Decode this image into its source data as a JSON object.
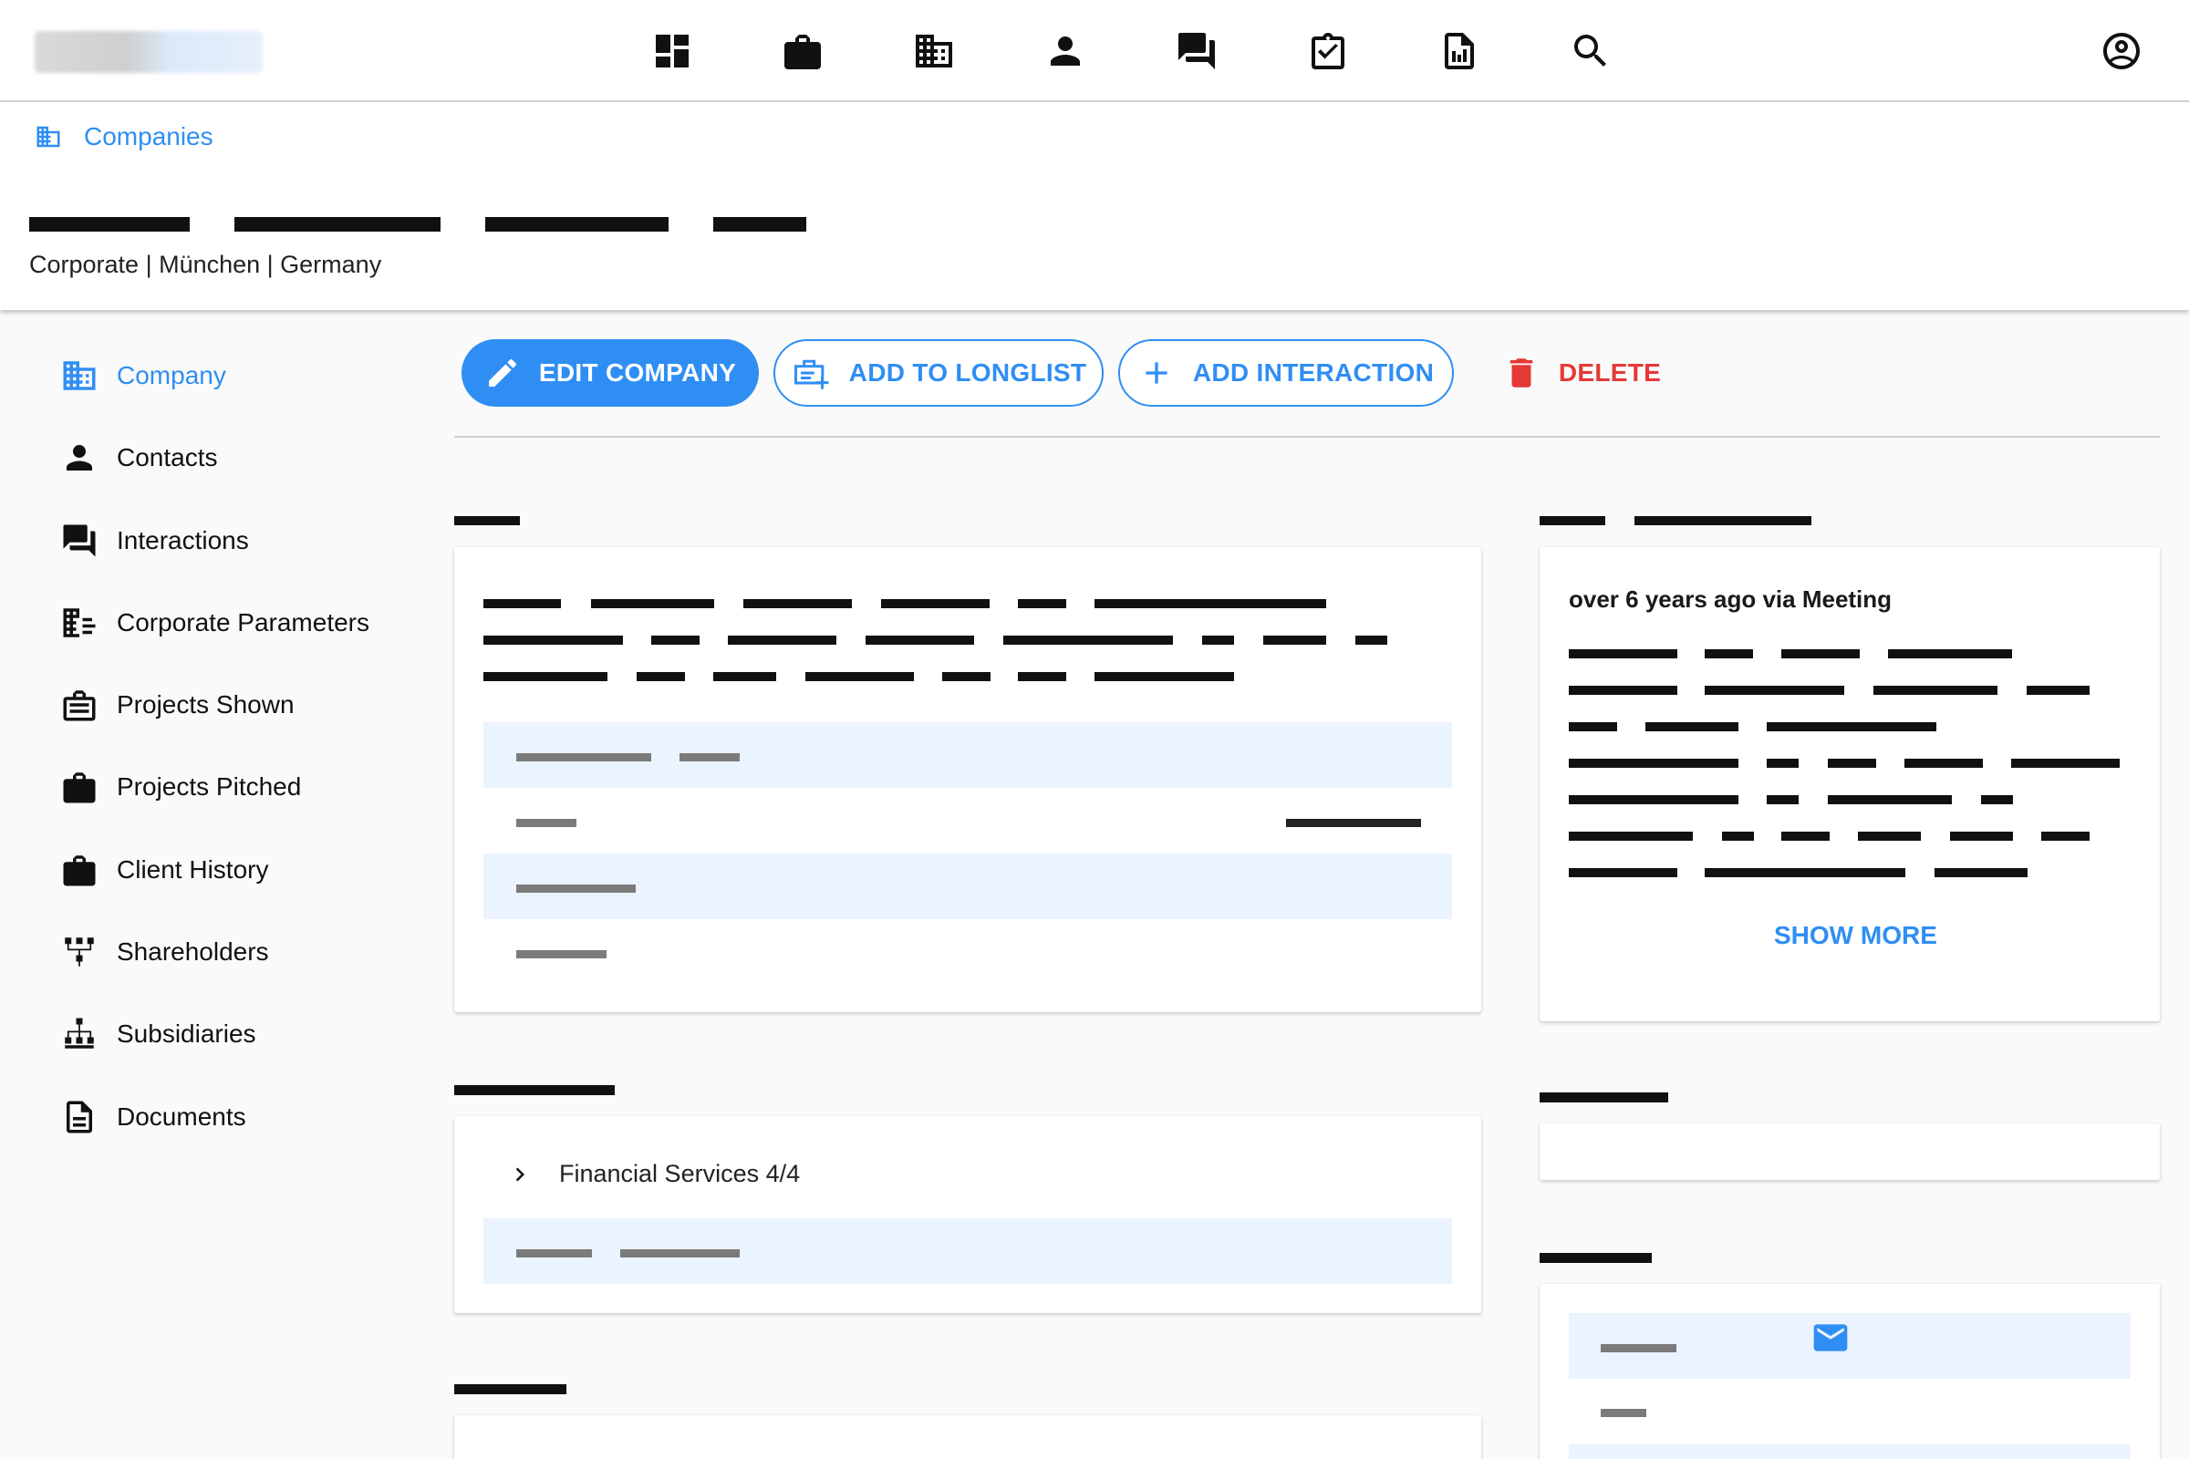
{
  "app": {
    "brand_colors": {
      "accent": "#2f8ef3",
      "danger": "#e53935",
      "row_highlight": "#eaf3fe"
    },
    "nav_icons": [
      "dashboard-icon",
      "briefcase-icon",
      "companies-icon",
      "person-icon",
      "forum-icon",
      "task-icon",
      "report-icon",
      "search-icon",
      "account-icon"
    ]
  },
  "breadcrumb": {
    "label": "Companies"
  },
  "company": {
    "subtitle": "Corporate | München | Germany"
  },
  "sidebar": {
    "items": [
      {
        "label": "Company",
        "icon": "business-icon",
        "active": true
      },
      {
        "label": "Contacts",
        "icon": "person-icon"
      },
      {
        "label": "Interactions",
        "icon": "forum-icon"
      },
      {
        "label": "Corporate Parameters",
        "icon": "domain-parameters-icon"
      },
      {
        "label": "Projects Shown",
        "icon": "work-outline-icon"
      },
      {
        "label": "Projects Pitched",
        "icon": "briefcase-icon"
      },
      {
        "label": "Client History",
        "icon": "briefcase-icon"
      },
      {
        "label": "Shareholders",
        "icon": "shareholders-icon"
      },
      {
        "label": "Subsidiaries",
        "icon": "subsidiaries-icon"
      },
      {
        "label": "Documents",
        "icon": "document-icon"
      }
    ]
  },
  "actions": {
    "edit": "EDIT COMPANY",
    "longlist": "ADD TO LONGLIST",
    "interaction": "ADD INTERACTION",
    "delete": "DELETE"
  },
  "last_interaction": {
    "meta": "over 6 years ago via Meeting",
    "show_more": "SHOW MORE"
  },
  "industries": {
    "row_label": "Financial Services 4/4"
  }
}
